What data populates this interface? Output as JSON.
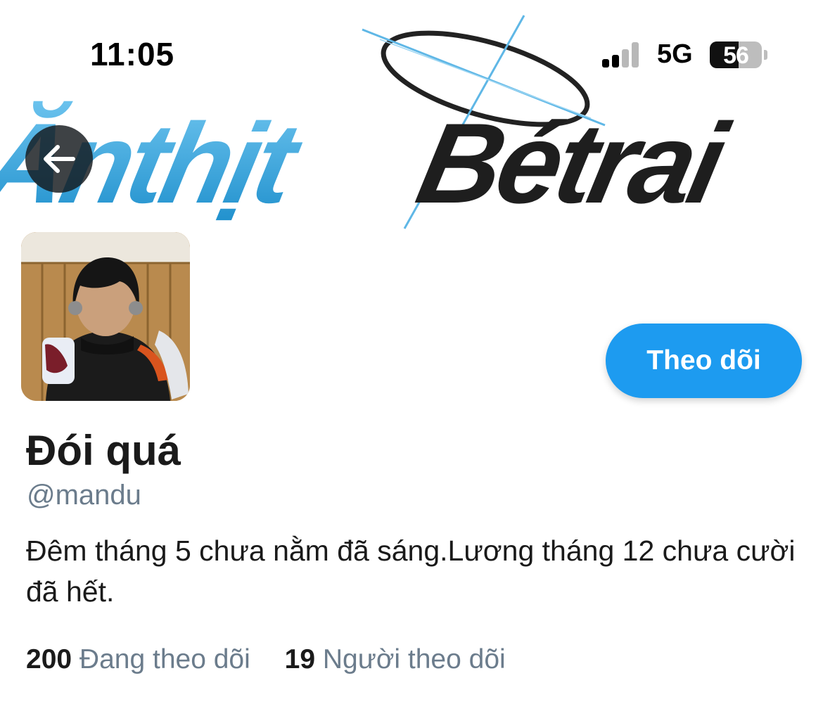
{
  "status_bar": {
    "time": "11:05",
    "network": "5G",
    "battery": "56",
    "battery_level": 0.56
  },
  "banner": {
    "logo_text_left": "Ănthịt",
    "logo_text_right": "Bétrai"
  },
  "profile": {
    "display_name": "Đói quá",
    "handle": "@mandu",
    "bio": "Đêm tháng 5 chưa nằm đã sáng.Lương tháng 12 chưa cười đã hết.",
    "follow_label": "Theo dõi",
    "following_count": "200",
    "following_label": "Đang theo dõi",
    "followers_count": "19",
    "followers_label": "Người theo dõi"
  },
  "colors": {
    "accent": "#1d9bf0",
    "logo_blue": "#2a9fd6",
    "logo_dark": "#1e1e1e",
    "muted_text": "#6b7c8c"
  },
  "icons": {
    "back": "arrow-left-icon",
    "signal": "signal-icon",
    "battery": "battery-icon"
  }
}
